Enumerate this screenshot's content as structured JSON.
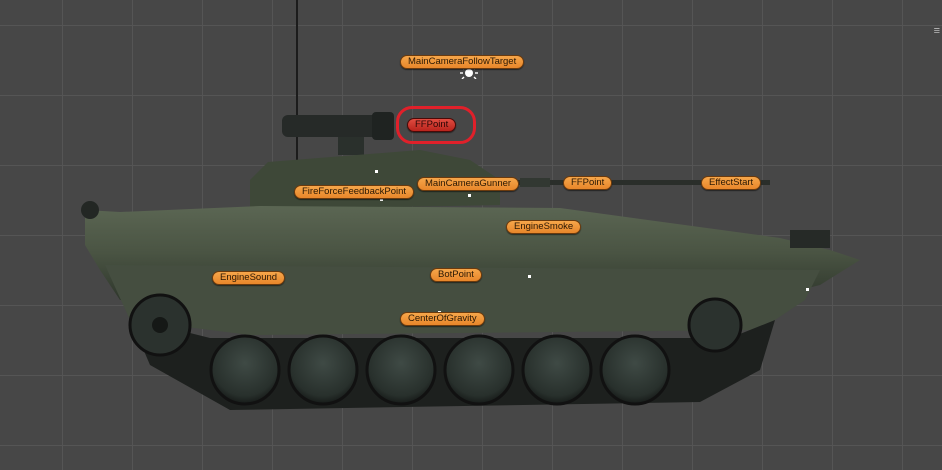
{
  "scene": {
    "corner_menu_icon": "hamburger-icon",
    "camera_gizmo_icon": "sun-light-icon"
  },
  "markers": {
    "main_camera_follow_target": "MainCameraFollowTarget",
    "ff_point_selected": "FFPoint",
    "fire_force_feedback_point": "FireForceFeedbackPoint",
    "main_camera_gunner": "MainCameraGunner",
    "ff_point": "FFPoint",
    "effect_start": "EffectStart",
    "engine_smoke": "EngineSmoke",
    "engine_sound": "EngineSound",
    "bot_point": "BotPoint",
    "center_of_gravity": "CenterOfGravity"
  },
  "colors": {
    "marker_fill": "#f09a3c",
    "marker_selected_fill": "#d23a30",
    "selection_ring": "#e0202a",
    "grid_background": "#474747"
  }
}
